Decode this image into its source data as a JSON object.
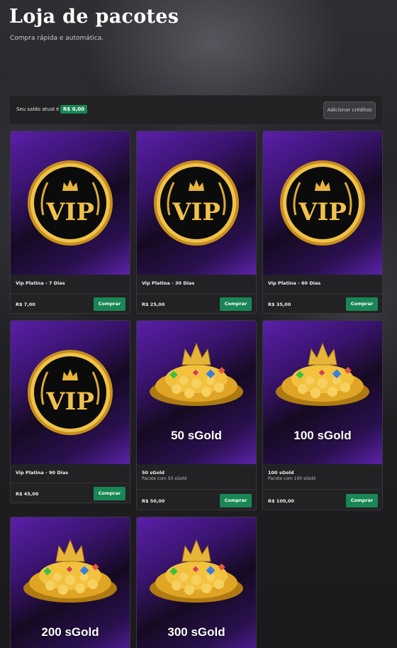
{
  "header": {
    "title": "Loja de pacotes",
    "subtitle": "Compra rápida e automática."
  },
  "balance": {
    "label": "Seu saldo atual é",
    "value": "R$ 0,00",
    "add_credits_label": "Adicionar créditos"
  },
  "buy_label": "Comprar",
  "vip_emblem_text": "VIP",
  "products": [
    {
      "name": "Vip Platina - 7 Dias",
      "description": "",
      "price": "R$ 7,00",
      "image": "vip-emblem",
      "image_label": ""
    },
    {
      "name": "Vip Platina - 30 Dias",
      "description": "",
      "price": "R$ 25,00",
      "image": "vip-emblem",
      "image_label": ""
    },
    {
      "name": "Vip Platina - 60 Dias",
      "description": "",
      "price": "R$ 35,00",
      "image": "vip-emblem",
      "image_label": ""
    },
    {
      "name": "Vip Platina - 90 Dias",
      "description": "",
      "price": "R$ 45,00",
      "image": "vip-emblem",
      "image_label": ""
    },
    {
      "name": "50 sGold",
      "description": "Pacote com 50 sGold",
      "price": "R$ 50,00",
      "image": "gold-treasure",
      "image_label": "50 sGold"
    },
    {
      "name": "100 sGold",
      "description": "Pacote com 100 sGold",
      "price": "R$ 100,00",
      "image": "gold-treasure",
      "image_label": "100 sGold"
    },
    {
      "name": "",
      "description": "",
      "price": "",
      "image": "gold-treasure",
      "image_label": "200 sGold"
    },
    {
      "name": "",
      "description": "",
      "price": "",
      "image": "gold-treasure",
      "image_label": "300 sGold"
    }
  ],
  "colors": {
    "accent_green": "#198754",
    "card_purple": "#5a1fa8",
    "gold": "#e6b53a"
  }
}
